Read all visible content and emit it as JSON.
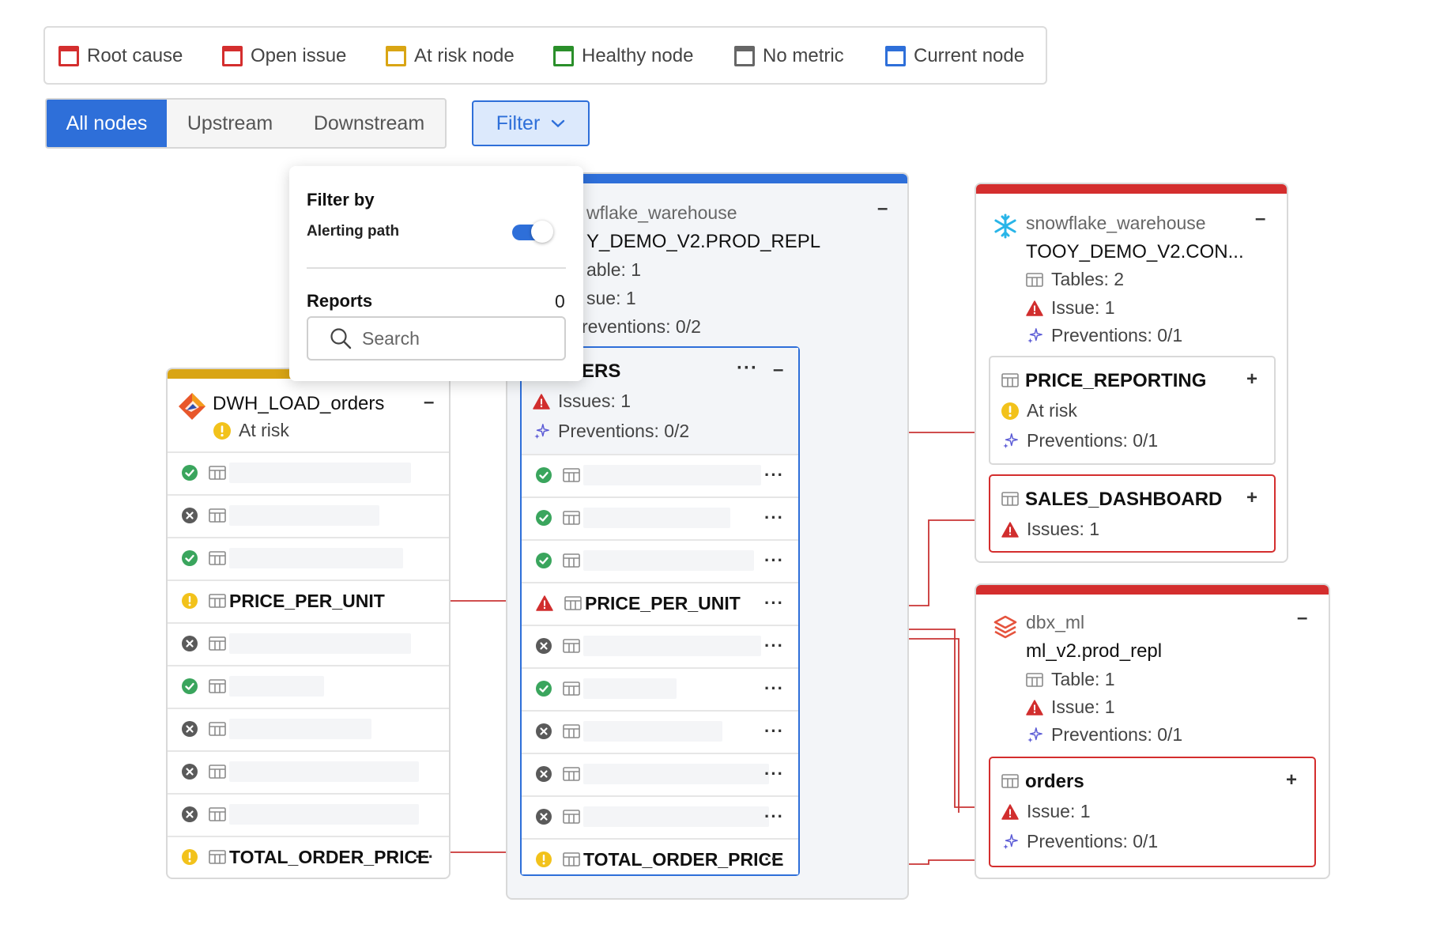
{
  "legend": [
    {
      "label": "Root cause",
      "color": "#d42e2e"
    },
    {
      "label": "Open issue",
      "color": "#d42e2e"
    },
    {
      "label": "At risk node",
      "color": "#d9a514"
    },
    {
      "label": "Healthy node",
      "color": "#2a8f2a"
    },
    {
      "label": "No metric",
      "color": "#666666"
    },
    {
      "label": "Current node",
      "color": "#2e6fd9"
    }
  ],
  "tabs": {
    "all": "All nodes",
    "upstream": "Upstream",
    "downstream": "Downstream"
  },
  "filter_button": "Filter",
  "popover": {
    "title": "Filter by",
    "alerting_path": "Alerting path",
    "alerting_path_on": true,
    "reports_label": "Reports",
    "reports_count": "0",
    "search_placeholder": "Search"
  },
  "dwh_node": {
    "title": "DWH_LOAD_orders",
    "status": "At risk",
    "collapse": "–",
    "columns": [
      {
        "status": "ok",
        "name": ""
      },
      {
        "status": "none",
        "name": ""
      },
      {
        "status": "ok",
        "name": ""
      },
      {
        "status": "risk",
        "name": "PRICE_PER_UNIT"
      },
      {
        "status": "none",
        "name": ""
      },
      {
        "status": "ok",
        "name": ""
      },
      {
        "status": "none",
        "name": ""
      },
      {
        "status": "none",
        "name": ""
      },
      {
        "status": "none",
        "name": ""
      },
      {
        "status": "risk",
        "name": "TOTAL_ORDER_PRICE",
        "more": "···"
      }
    ]
  },
  "center_node": {
    "source": "wflake_warehouse",
    "db": "Y_DEMO_V2.PROD_REPL",
    "tables": "able: 1",
    "issues": "sue: 1",
    "preventions": "reventions: 0/2",
    "collapse": "–",
    "inner": {
      "title": "ERS",
      "more": "···",
      "collapse": "–",
      "issues": "Issues: 1",
      "preventions": "Preventions: 0/2",
      "columns": [
        {
          "status": "ok",
          "name": "",
          "more": "···"
        },
        {
          "status": "ok",
          "name": "",
          "more": "···"
        },
        {
          "status": "ok",
          "name": "",
          "more": "···"
        },
        {
          "status": "issue",
          "name": "PRICE_PER_UNIT",
          "more": "···"
        },
        {
          "status": "none",
          "name": "",
          "more": "···"
        },
        {
          "status": "ok",
          "name": "",
          "more": "···"
        },
        {
          "status": "none",
          "name": "",
          "more": "···"
        },
        {
          "status": "none",
          "name": "",
          "more": "···"
        },
        {
          "status": "none",
          "name": "",
          "more": "···"
        },
        {
          "status": "risk",
          "name": "TOTAL_ORDER_PRICE",
          "more": "···"
        }
      ]
    }
  },
  "snowflake_node": {
    "source": "snowflake_warehouse",
    "db": "TOOY_DEMO_V2.CON...",
    "collapse": "–",
    "tables": "Tables: 2",
    "issue": "Issue: 1",
    "preventions": "Preventions: 0/1",
    "children": [
      {
        "title": "PRICE_REPORTING",
        "expand": "+",
        "status": "At risk",
        "preventions": "Preventions: 0/1"
      },
      {
        "title": "SALES_DASHBOARD",
        "expand": "+",
        "issues": "Issues: 1"
      }
    ]
  },
  "dbx_node": {
    "source": "dbx_ml",
    "db": "ml_v2.prod_repl",
    "collapse": "–",
    "tables": "Table: 1",
    "issue": "Issue: 1",
    "preventions": "Preventions: 0/1",
    "child": {
      "title": "orders",
      "expand": "+",
      "issue": "Issue: 1",
      "preventions": "Preventions: 0/1"
    }
  }
}
